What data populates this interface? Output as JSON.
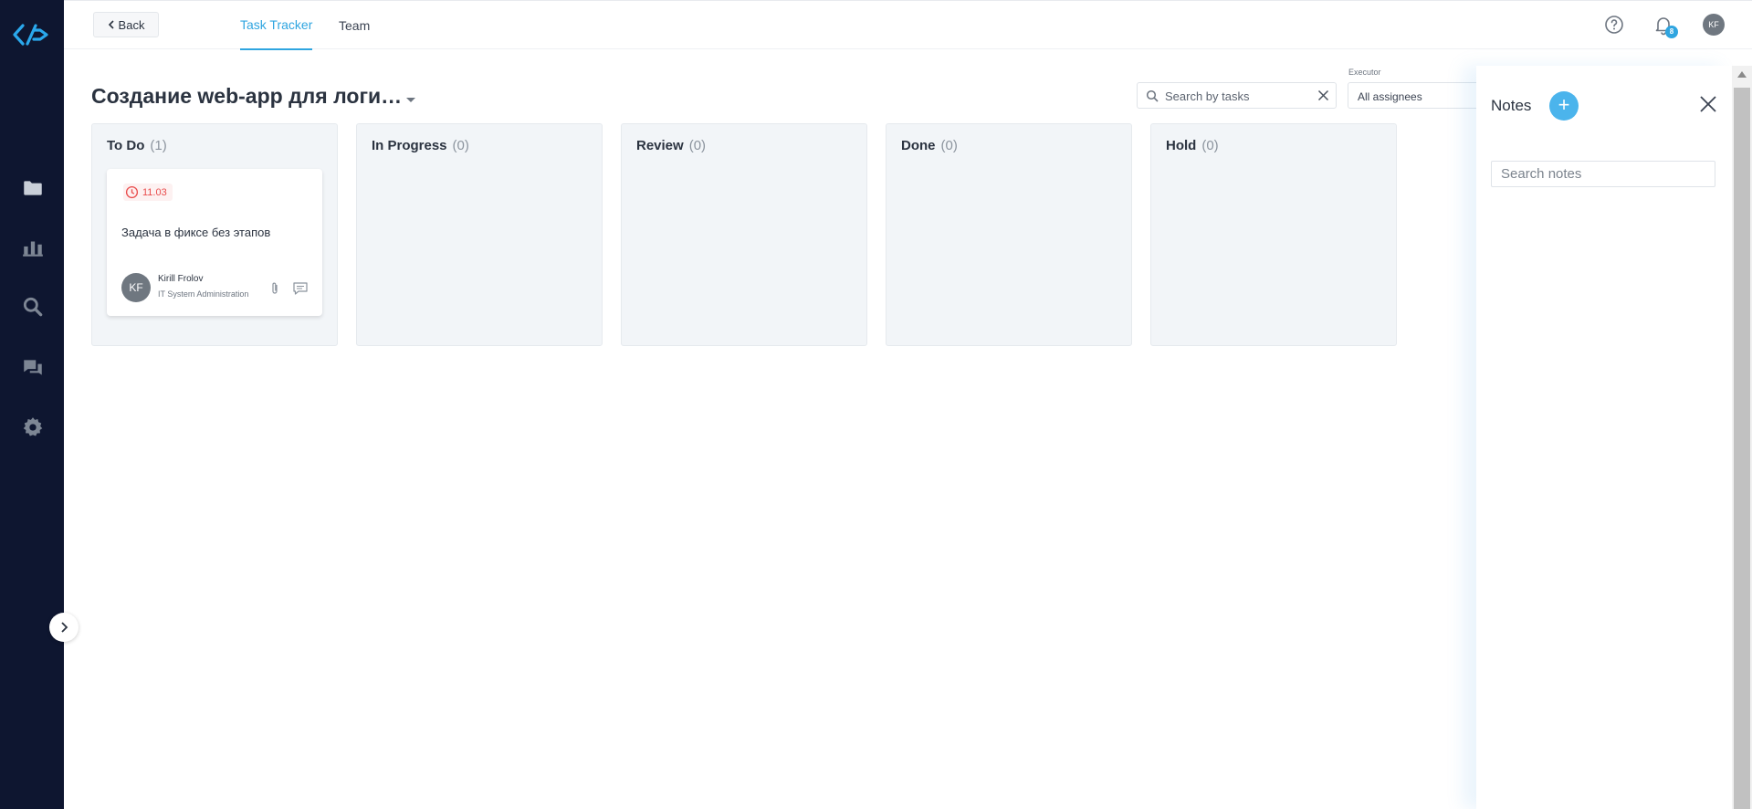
{
  "sidebar": {
    "logo": "brand-logo",
    "items": [
      {
        "name": "folder-icon"
      },
      {
        "name": "bar-chart-icon"
      },
      {
        "name": "search-icon"
      },
      {
        "name": "chat-icon"
      },
      {
        "name": "gear-icon"
      }
    ],
    "expand_icon": "chevron-right-icon"
  },
  "header": {
    "back_label": "Back",
    "tabs": [
      {
        "label": "Task Tracker",
        "active": true
      },
      {
        "label": "Team",
        "active": false
      }
    ],
    "notifications_count": "8",
    "user_initials": "KF"
  },
  "project": {
    "title": "Создание web-app для логи…",
    "search_placeholder": "Search by tasks",
    "executor_label": "Executor",
    "executor_value": "All assignees"
  },
  "columns": [
    {
      "title": "To Do",
      "count": "(1)"
    },
    {
      "title": "In Progress",
      "count": "(0)"
    },
    {
      "title": "Review",
      "count": "(0)"
    },
    {
      "title": "Done",
      "count": "(0)"
    },
    {
      "title": "Hold",
      "count": "(0)"
    }
  ],
  "task_card": {
    "due_date": "11.03",
    "title": "Задача в фиксе без этапов",
    "assignee_initials": "KF",
    "assignee_name": "Kirill Frolov",
    "assignee_department": "IT System Administration"
  },
  "notes": {
    "title": "Notes",
    "add_label": "+",
    "search_placeholder": "Search notes"
  },
  "colors": {
    "sidebar_bg": "#0e1630",
    "accent": "#2fa5e0",
    "overdue": "#e94b4b",
    "column_bg": "#f2f5f8"
  }
}
